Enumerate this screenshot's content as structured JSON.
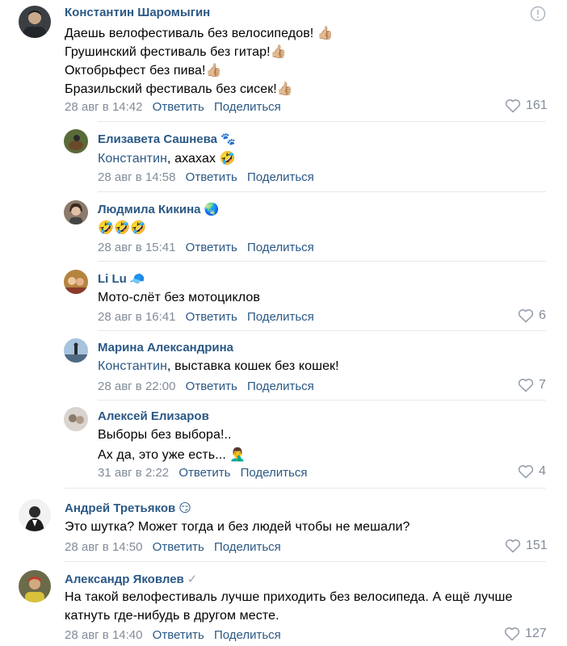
{
  "comments": [
    {
      "author": "Константин Шаромыгин",
      "author_emoji": "",
      "lines": [
        "Даешь велофестиваль без велосипедов! 👍🏼",
        "Грушинский фестиваль без гитар!👍🏼",
        "Октобрьфест без пива!👍🏼",
        "Бразильский фестиваль без сисек!👍🏼"
      ],
      "date": "28 авг в 14:42",
      "reply_label": "Ответить",
      "share_label": "Поделиться",
      "likes": "161"
    },
    {
      "author": "Елизавета Сашнева",
      "author_emoji": "🐾",
      "mention": "Константин",
      "text_after_mention": ", ахахах 🤣",
      "date": "28 авг в 14:58",
      "reply_label": "Ответить",
      "share_label": "Поделиться"
    },
    {
      "author": "Людмила Кикина",
      "author_emoji": "🌏",
      "lines": [
        "🤣🤣🤣"
      ],
      "date": "28 авг в 15:41",
      "reply_label": "Ответить",
      "share_label": "Поделиться"
    },
    {
      "author": "Li Lu",
      "author_emoji": "🧢",
      "lines": [
        "Мото-слёт без мотоциклов"
      ],
      "date": "28 авг в 16:41",
      "reply_label": "Ответить",
      "share_label": "Поделиться",
      "likes": "6"
    },
    {
      "author": "Марина Александрина",
      "author_emoji": "",
      "mention": "Константин",
      "text_after_mention": ", выставка кошек без кошек!",
      "date": "28 авг в 22:00",
      "reply_label": "Ответить",
      "share_label": "Поделиться",
      "likes": "7"
    },
    {
      "author": "Алексей Елизаров",
      "author_emoji": "",
      "lines": [
        "Выборы без выбора!..",
        "Ах да, это уже есть... 🤦‍♂️"
      ],
      "date": "31 авг в 2:22",
      "reply_label": "Ответить",
      "share_label": "Поделиться",
      "likes": "4"
    },
    {
      "author": "Андрей Третьяков",
      "author_emoji": "😏",
      "lines": [
        "Это шутка? Может тогда и без людей чтобы не мешали?"
      ],
      "date": "28 авг в 14:50",
      "reply_label": "Ответить",
      "share_label": "Поделиться",
      "likes": "151"
    },
    {
      "author": "Александр Яковлев",
      "author_emoji": "✓",
      "lines": [
        "На такой велофестиваль лучше приходить без велосипеда. А ещё лучше",
        "катнуть где-нибудь в другом месте."
      ],
      "date": "28 авг в 14:40",
      "reply_label": "Ответить",
      "share_label": "Поделиться",
      "likes": "127"
    }
  ]
}
